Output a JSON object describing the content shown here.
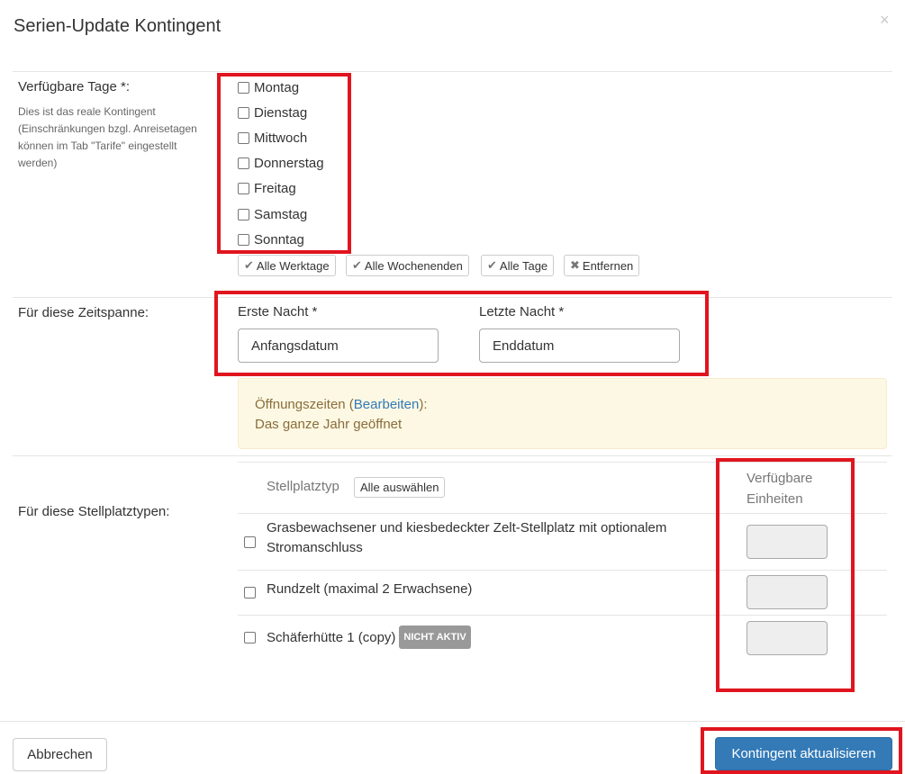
{
  "modal": {
    "title": "Serien-Update Kontingent",
    "close_glyph": "×"
  },
  "days": {
    "label": "Verfügbare Tage *:",
    "help": "Dies ist das reale Kontingent (Einschränkungen bzgl. Anreisetagen können im Tab \"Tarife\" eingestellt werden)",
    "items": [
      {
        "label": "Montag",
        "checked": false
      },
      {
        "label": "Dienstag",
        "checked": false
      },
      {
        "label": "Mittwoch",
        "checked": false
      },
      {
        "label": "Donnerstag",
        "checked": false
      },
      {
        "label": "Freitag",
        "checked": false
      },
      {
        "label": "Samstag",
        "checked": false
      },
      {
        "label": "Sonntag",
        "checked": false
      }
    ],
    "quick_buttons": {
      "weekdays": "Alle Werktage",
      "weekends": "Alle Wochenenden",
      "all_days": "Alle Tage",
      "remove": "Entfernen"
    }
  },
  "period": {
    "label": "Für diese Zeitspanne:",
    "first_night_label": "Erste Nacht *",
    "first_night_value": "Anfangsdatum",
    "last_night_label": "Letzte Nacht *",
    "last_night_value": "Enddatum"
  },
  "opening": {
    "prefix": "Öffnungszeiten (",
    "link": "Bearbeiten",
    "suffix": "):",
    "text": "Das ganze Jahr geöffnet"
  },
  "pitches": {
    "label": "Für diese Stellplatztypen:",
    "col_type": "Stellplatztyp",
    "select_all": "Alle auswählen",
    "col_units_line1": "Verfügbare",
    "col_units_line2": "Einheiten",
    "rows": [
      {
        "name": "Grasbewachsener und kiesbedeckter Zelt-Stellplatz mit optionalem Stromanschluss",
        "badge": "",
        "units": ""
      },
      {
        "name": "Rundzelt (maximal 2 Erwachsene)",
        "badge": "",
        "units": ""
      },
      {
        "name": "Schäferhütte 1 (copy)",
        "badge": "NICHT AKTIV",
        "units": ""
      }
    ]
  },
  "footer": {
    "cancel": "Abbrechen",
    "submit": "Kontingent aktualisieren"
  },
  "colors": {
    "highlight": "#e0151f",
    "primary": "#337ab7",
    "alert_bg": "#fcf8e3",
    "alert_text": "#8a6d3b"
  }
}
